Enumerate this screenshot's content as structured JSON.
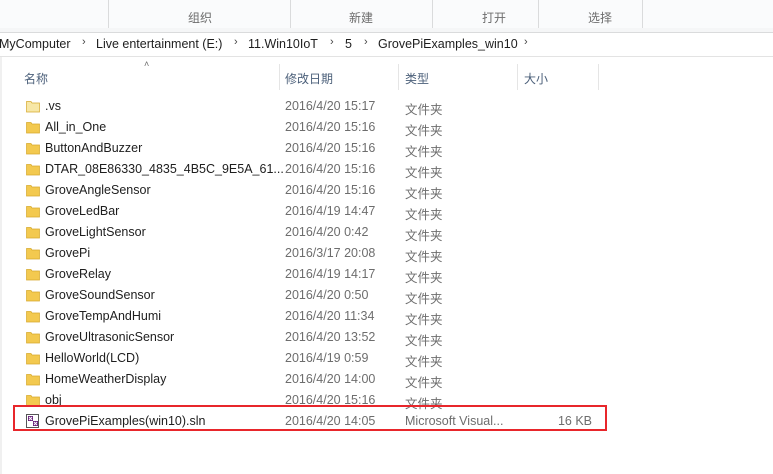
{
  "ribbon": {
    "groups": [
      "组织",
      "新建",
      "打开",
      "选择"
    ]
  },
  "breadcrumb": {
    "items": [
      "MyComputer",
      "Live entertainment (E:)",
      "11.Win10IoT",
      "5",
      "GrovePiExamples_win10"
    ]
  },
  "columns": {
    "name": "名称",
    "date": "修改日期",
    "type": "类型",
    "size": "大小"
  },
  "files": [
    {
      "name": ".vs",
      "date": "2016/4/20 15:17",
      "type": "文件夹",
      "size": "",
      "icon": "folder-pale-icon"
    },
    {
      "name": "All_in_One",
      "date": "2016/4/20 15:16",
      "type": "文件夹",
      "size": "",
      "icon": "folder-icon"
    },
    {
      "name": "ButtonAndBuzzer",
      "date": "2016/4/20 15:16",
      "type": "文件夹",
      "size": "",
      "icon": "folder-icon"
    },
    {
      "name": "DTAR_08E86330_4835_4B5C_9E5A_61...",
      "date": "2016/4/20 15:16",
      "type": "文件夹",
      "size": "",
      "icon": "folder-icon"
    },
    {
      "name": "GroveAngleSensor",
      "date": "2016/4/20 15:16",
      "type": "文件夹",
      "size": "",
      "icon": "folder-icon"
    },
    {
      "name": "GroveLedBar",
      "date": "2016/4/19 14:47",
      "type": "文件夹",
      "size": "",
      "icon": "folder-icon"
    },
    {
      "name": "GroveLightSensor",
      "date": "2016/4/20 0:42",
      "type": "文件夹",
      "size": "",
      "icon": "folder-icon"
    },
    {
      "name": "GrovePi",
      "date": "2016/3/17 20:08",
      "type": "文件夹",
      "size": "",
      "icon": "folder-icon"
    },
    {
      "name": "GroveRelay",
      "date": "2016/4/19 14:17",
      "type": "文件夹",
      "size": "",
      "icon": "folder-icon"
    },
    {
      "name": "GroveSoundSensor",
      "date": "2016/4/20 0:50",
      "type": "文件夹",
      "size": "",
      "icon": "folder-icon"
    },
    {
      "name": "GroveTempAndHumi",
      "date": "2016/4/20 11:34",
      "type": "文件夹",
      "size": "",
      "icon": "folder-icon"
    },
    {
      "name": "GroveUltrasonicSensor",
      "date": "2016/4/20 13:52",
      "type": "文件夹",
      "size": "",
      "icon": "folder-icon"
    },
    {
      "name": "HelloWorld(LCD)",
      "date": "2016/4/19 0:59",
      "type": "文件夹",
      "size": "",
      "icon": "folder-icon"
    },
    {
      "name": "HomeWeatherDisplay",
      "date": "2016/4/20 14:00",
      "type": "文件夹",
      "size": "",
      "icon": "folder-icon"
    },
    {
      "name": "obj",
      "date": "2016/4/20 15:16",
      "type": "文件夹",
      "size": "",
      "icon": "folder-icon"
    },
    {
      "name": "GrovePiExamples(win10).sln",
      "date": "2016/4/20 14:05",
      "type": "Microsoft Visual...",
      "size": "16 KB",
      "icon": "visual-studio-solution-icon"
    }
  ],
  "colors": {
    "folder": "#f3c94f",
    "folder_pale": "#f7e7a6",
    "highlight": "#e8262b",
    "header_text": "#4c607a"
  }
}
